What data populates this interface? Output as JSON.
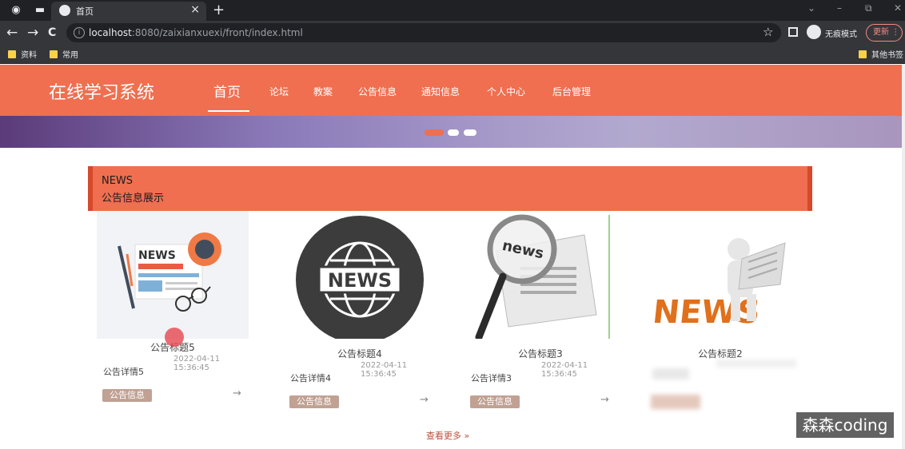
{
  "browser": {
    "tab_title": "首页",
    "close_glyph": "×",
    "new_tab_glyph": "+",
    "url_host": "localhost",
    "url_path": ":8080/zaixianxuexi/front/index.html",
    "incognito_label": "无痕模式",
    "update_label": "更新",
    "update_menu_glyph": "⋮",
    "bookmarks": [
      "资料",
      "常用"
    ],
    "other_bookmarks": "其他书签",
    "back_glyph": "←",
    "forward_glyph": "→",
    "reload_glyph": "C",
    "star_glyph": "☆",
    "window_controls": [
      "⌄",
      "–",
      "⧉",
      "✕"
    ]
  },
  "site": {
    "logo": "在线学习系统",
    "nav": [
      "首页",
      "论坛",
      "教案",
      "公告信息",
      "通知信息",
      "个人中心",
      "后台管理"
    ]
  },
  "news_section": {
    "label_en": "NEWS",
    "label_cn": "公告信息展示"
  },
  "cards": [
    {
      "image": "news-flatlay-illustration",
      "title": "公告标题5",
      "date": "2022-04-11 15:36:45",
      "desc": "公告详情5",
      "badge": "公告信息",
      "arrow": "→"
    },
    {
      "image": "news-globe-illustration",
      "title": "公告标题4",
      "date": "2022-04-11 15:36:45",
      "desc": "公告详情4",
      "badge": "公告信息",
      "arrow": "→"
    },
    {
      "image": "news-magnifier-illustration",
      "title": "公告标题3",
      "date": "2022-04-11 15:36:45",
      "desc": "公告详情3",
      "badge": "公告信息",
      "arrow": "→"
    },
    {
      "image": "news-3d-figure-illustration",
      "title": "公告标题2"
    }
  ],
  "more_link": "查看更多 »",
  "watermark": "森森coding",
  "colors": {
    "brand": "#ef6f50",
    "brand_dark": "#d6492b",
    "badge": "#c0a193"
  }
}
